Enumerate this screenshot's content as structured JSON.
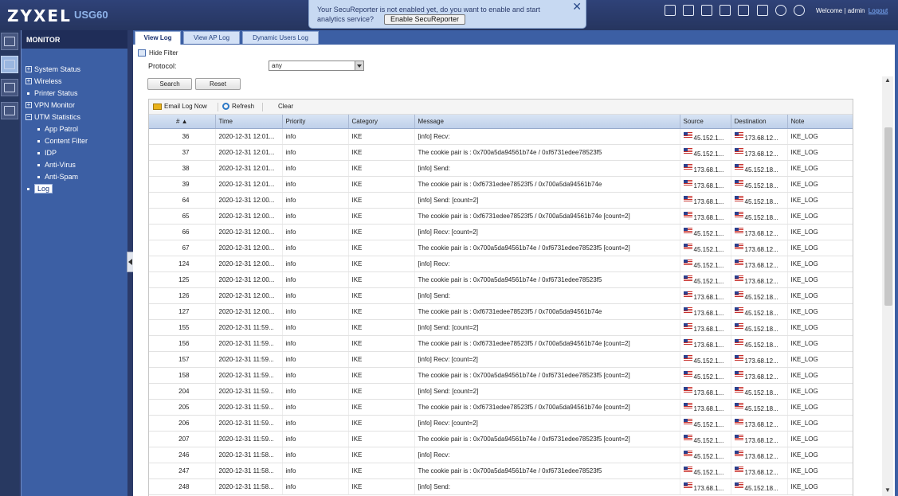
{
  "header": {
    "logo": "ZYXEL",
    "model": "USG60",
    "welcome": "Welcome | admin",
    "logout": "Logout",
    "icons": [
      "console-icon",
      "cli-icon",
      "window-icon",
      "sitemap-icon",
      "chat-icon",
      "help-icon",
      "info-icon",
      "wizard-icon"
    ]
  },
  "notice": {
    "line1": "Your SecuReporter is not enabled yet, do you want to enable and start",
    "line2": "analytics service?",
    "button": "Enable SecuReporter",
    "close": "✕"
  },
  "sidebar": {
    "title": "MONITOR",
    "items": [
      {
        "label": "System Status",
        "type": "tree"
      },
      {
        "label": "Wireless",
        "type": "tree"
      },
      {
        "label": "Printer Status",
        "type": "leaf"
      },
      {
        "label": "VPN Monitor",
        "type": "tree"
      },
      {
        "label": "UTM Statistics",
        "type": "tree"
      },
      {
        "label": "App Patrol",
        "type": "sub"
      },
      {
        "label": "Content Filter",
        "type": "sub"
      },
      {
        "label": "IDP",
        "type": "sub"
      },
      {
        "label": "Anti-Virus",
        "type": "sub"
      },
      {
        "label": "Anti-Spam",
        "type": "sub"
      },
      {
        "label": "Log",
        "type": "selected"
      }
    ]
  },
  "tabs": [
    "View Log",
    "View AP Log",
    "Dynamic Users Log"
  ],
  "filter": {
    "hide_filter": "Hide Filter",
    "protocol_label": "Protocol:",
    "protocol_value": "any",
    "search": "Search",
    "reset": "Reset"
  },
  "toolbar": {
    "email": "Email Log Now",
    "refresh": "Refresh",
    "clear": "Clear"
  },
  "table": {
    "headers": [
      "# ▲",
      "Time",
      "Priority",
      "Category",
      "Message",
      "Source",
      "Destination",
      "Note"
    ],
    "rows": [
      [
        "36",
        "2020-12-31 12:01...",
        "info",
        "IKE",
        "[info] Recv:",
        "45.152.1...",
        "173.68.12...",
        "IKE_LOG"
      ],
      [
        "37",
        "2020-12-31 12:01...",
        "info",
        "IKE",
        "The cookie pair is : 0x700a5da94561b74e / 0xf6731edee78523f5",
        "45.152.1...",
        "173.68.12...",
        "IKE_LOG"
      ],
      [
        "38",
        "2020-12-31 12:01...",
        "info",
        "IKE",
        "[info] Send:",
        "173.68.1...",
        "45.152.18...",
        "IKE_LOG"
      ],
      [
        "39",
        "2020-12-31 12:01...",
        "info",
        "IKE",
        "The cookie pair is : 0xf6731edee78523f5 / 0x700a5da94561b74e",
        "173.68.1...",
        "45.152.18...",
        "IKE_LOG"
      ],
      [
        "64",
        "2020-12-31 12:00...",
        "info",
        "IKE",
        "[info] Send: [count=2]",
        "173.68.1...",
        "45.152.18...",
        "IKE_LOG"
      ],
      [
        "65",
        "2020-12-31 12:00...",
        "info",
        "IKE",
        "The cookie pair is : 0xf6731edee78523f5 / 0x700a5da94561b74e [count=2]",
        "173.68.1...",
        "45.152.18...",
        "IKE_LOG"
      ],
      [
        "66",
        "2020-12-31 12:00...",
        "info",
        "IKE",
        "[info] Recv: [count=2]",
        "45.152.1...",
        "173.68.12...",
        "IKE_LOG"
      ],
      [
        "67",
        "2020-12-31 12:00...",
        "info",
        "IKE",
        "The cookie pair is : 0x700a5da94561b74e / 0xf6731edee78523f5 [count=2]",
        "45.152.1...",
        "173.68.12...",
        "IKE_LOG"
      ],
      [
        "124",
        "2020-12-31 12:00...",
        "info",
        "IKE",
        "[info] Recv:",
        "45.152.1...",
        "173.68.12...",
        "IKE_LOG"
      ],
      [
        "125",
        "2020-12-31 12:00...",
        "info",
        "IKE",
        "The cookie pair is : 0x700a5da94561b74e / 0xf6731edee78523f5",
        "45.152.1...",
        "173.68.12...",
        "IKE_LOG"
      ],
      [
        "126",
        "2020-12-31 12:00...",
        "info",
        "IKE",
        "[info] Send:",
        "173.68.1...",
        "45.152.18...",
        "IKE_LOG"
      ],
      [
        "127",
        "2020-12-31 12:00...",
        "info",
        "IKE",
        "The cookie pair is : 0xf6731edee78523f5 / 0x700a5da94561b74e",
        "173.68.1...",
        "45.152.18...",
        "IKE_LOG"
      ],
      [
        "155",
        "2020-12-31 11:59...",
        "info",
        "IKE",
        "[info] Send: [count=2]",
        "173.68.1...",
        "45.152.18...",
        "IKE_LOG"
      ],
      [
        "156",
        "2020-12-31 11:59...",
        "info",
        "IKE",
        "The cookie pair is : 0xf6731edee78523f5 / 0x700a5da94561b74e [count=2]",
        "173.68.1...",
        "45.152.18...",
        "IKE_LOG"
      ],
      [
        "157",
        "2020-12-31 11:59...",
        "info",
        "IKE",
        "[info] Recv: [count=2]",
        "45.152.1...",
        "173.68.12...",
        "IKE_LOG"
      ],
      [
        "158",
        "2020-12-31 11:59...",
        "info",
        "IKE",
        "The cookie pair is : 0x700a5da94561b74e / 0xf6731edee78523f5 [count=2]",
        "45.152.1...",
        "173.68.12...",
        "IKE_LOG"
      ],
      [
        "204",
        "2020-12-31 11:59...",
        "info",
        "IKE",
        "[info] Send: [count=2]",
        "173.68.1...",
        "45.152.18...",
        "IKE_LOG"
      ],
      [
        "205",
        "2020-12-31 11:59...",
        "info",
        "IKE",
        "The cookie pair is : 0xf6731edee78523f5 / 0x700a5da94561b74e [count=2]",
        "173.68.1...",
        "45.152.18...",
        "IKE_LOG"
      ],
      [
        "206",
        "2020-12-31 11:59...",
        "info",
        "IKE",
        "[info] Recv: [count=2]",
        "45.152.1...",
        "173.68.12...",
        "IKE_LOG"
      ],
      [
        "207",
        "2020-12-31 11:59...",
        "info",
        "IKE",
        "The cookie pair is : 0x700a5da94561b74e / 0xf6731edee78523f5 [count=2]",
        "45.152.1...",
        "173.68.12...",
        "IKE_LOG"
      ],
      [
        "246",
        "2020-12-31 11:58...",
        "info",
        "IKE",
        "[info] Recv:",
        "45.152.1...",
        "173.68.12...",
        "IKE_LOG"
      ],
      [
        "247",
        "2020-12-31 11:58...",
        "info",
        "IKE",
        "The cookie pair is : 0x700a5da94561b74e / 0xf6731edee78523f5",
        "45.152.1...",
        "173.68.12...",
        "IKE_LOG"
      ],
      [
        "248",
        "2020-12-31 11:58...",
        "info",
        "IKE",
        "[info] Send:",
        "173.68.1...",
        "45.152.18...",
        "IKE_LOG"
      ]
    ]
  },
  "colors": {
    "header_bg": "#2b3a68",
    "sidebar_bg": "#3c5fa4",
    "notice_bg": "#c7d9f2",
    "table_header_bg": "#c9d8ee"
  }
}
